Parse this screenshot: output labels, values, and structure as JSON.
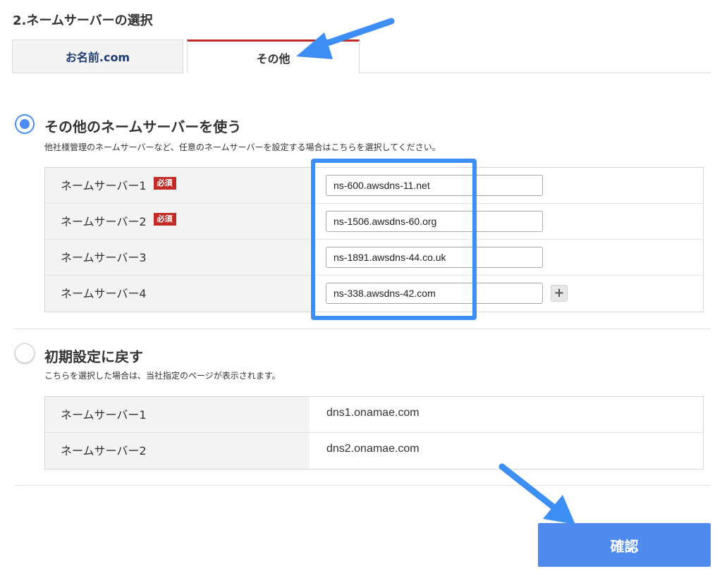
{
  "section_title": "2.ネームサーバーの選択",
  "tabs": [
    {
      "label": "お名前.com",
      "active": false
    },
    {
      "label": "その他",
      "active": true
    }
  ],
  "option_other": {
    "title": "その他のネームサーバーを使う",
    "description": "他社様管理のネームサーバーなど、任意のネームサーバーを設定する場合はこちらを選択してください。",
    "selected": true,
    "rows": [
      {
        "label": "ネームサーバー1",
        "required": true,
        "value": "ns-600.awsdns-11.net"
      },
      {
        "label": "ネームサーバー2",
        "required": true,
        "value": "ns-1506.awsdns-60.org"
      },
      {
        "label": "ネームサーバー3",
        "required": false,
        "value": "ns-1891.awsdns-44.co.uk"
      },
      {
        "label": "ネームサーバー4",
        "required": false,
        "value": "ns-338.awsdns-42.com"
      }
    ],
    "required_label": "必須",
    "add_button": "+"
  },
  "option_default": {
    "title": "初期設定に戻す",
    "description": "こちらを選択した場合は、当社指定のページが表示されます。",
    "selected": false,
    "rows": [
      {
        "label": "ネームサーバー1",
        "value": "dns1.onamae.com"
      },
      {
        "label": "ネームサーバー2",
        "value": "dns2.onamae.com"
      }
    ]
  },
  "confirm_button": "確認",
  "colors": {
    "accent_blue": "#4f8aef",
    "tab_active_border": "#c32b26",
    "required_badge": "#c32b26",
    "annotation_blue": "#3d8ef5"
  },
  "icons": [
    "plus-icon",
    "annotation-arrow-icon"
  ]
}
